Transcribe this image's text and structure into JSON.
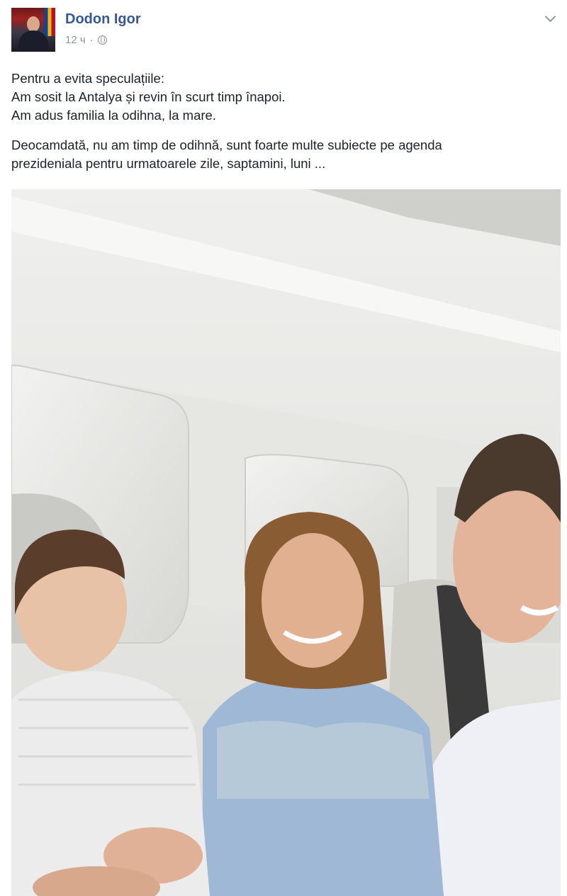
{
  "post": {
    "author": "Dodon Igor",
    "time": "12 ч",
    "separator": "·",
    "text_lines": [
      "Pentru a evita speculațiile:",
      "Am sosit la Antalya și revin în scurt timp înapoi.",
      "Am adus familia la odihna, la mare."
    ],
    "text_paragraph2_lines": [
      "Deocamdată, nu am timp de odihnă, sunt foarte multe subiecte pe agenda",
      "prezideniala pentru urmatoarele zile, saptamini, luni ..."
    ]
  },
  "icons": {
    "privacy": "globe-icon",
    "menu": "chevron-down-icon"
  },
  "colors": {
    "author_link": "#365899",
    "meta_text": "#90949c",
    "body_text": "#1d2129"
  }
}
